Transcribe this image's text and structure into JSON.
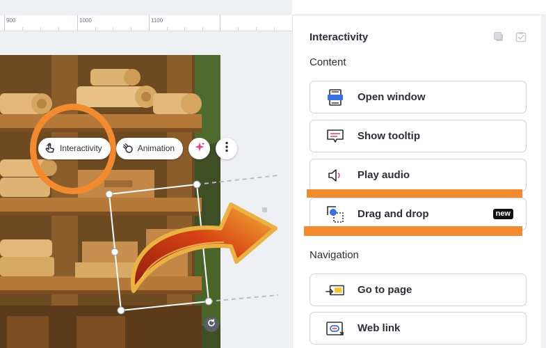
{
  "ruler": {
    "labels": [
      "900",
      "1000",
      "1100"
    ]
  },
  "toolbar": {
    "interactivity_label": "Interactivity",
    "animation_label": "Animation"
  },
  "panel": {
    "title": "Interactivity",
    "content_heading": "Content",
    "navigation_heading": "Navigation",
    "options": {
      "open_window": "Open window",
      "show_tooltip": "Show tooltip",
      "play_audio": "Play audio",
      "drag_and_drop": "Drag and drop",
      "drag_and_drop_badge": "new",
      "go_to_page": "Go to page",
      "web_link": "Web link"
    }
  },
  "colors": {
    "highlight_orange": "#f28b30",
    "accent_blue": "#3b6fe0",
    "accent_pink": "#e0457b",
    "accent_purple": "#7a4fd6"
  }
}
